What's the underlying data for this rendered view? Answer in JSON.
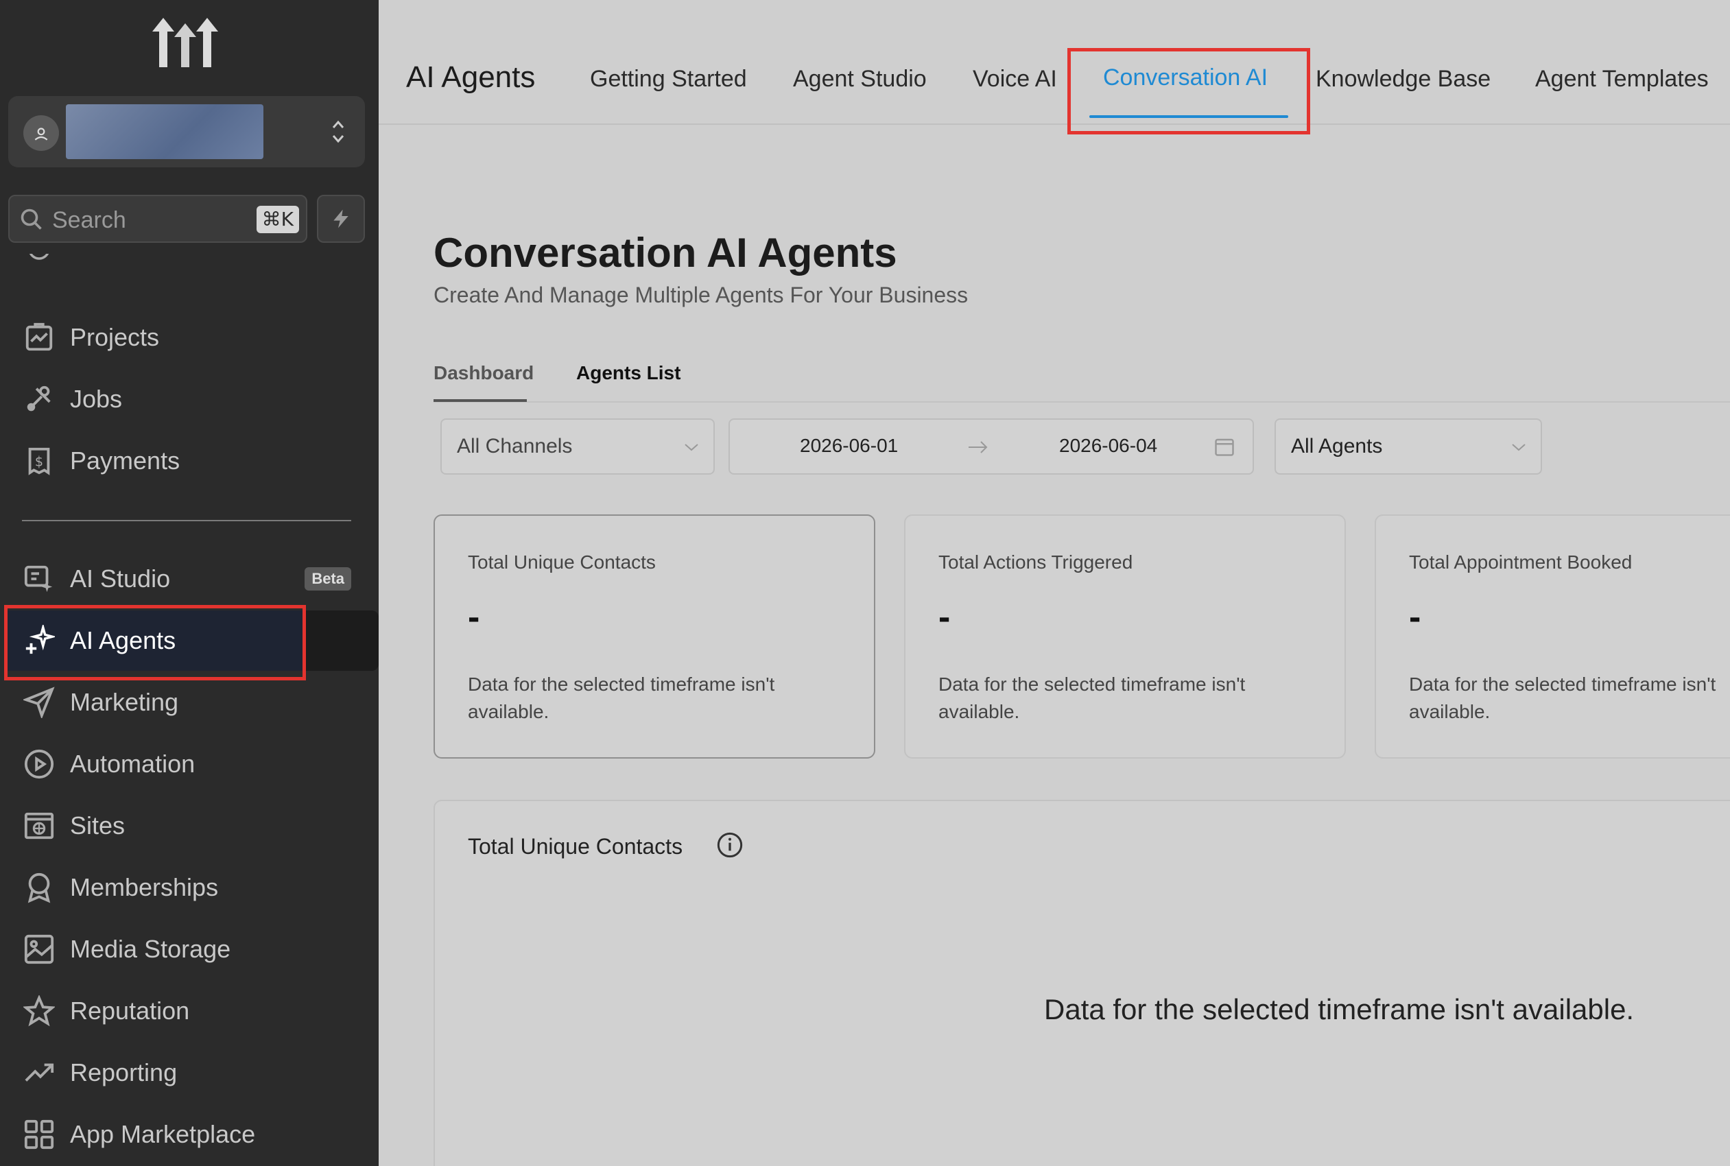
{
  "sidebar": {
    "search": {
      "placeholder": "Search",
      "shortcut": "⌘K"
    },
    "items": [
      {
        "label": "Projects",
        "icon": "projects-icon"
      },
      {
        "label": "Jobs",
        "icon": "tools-icon"
      },
      {
        "label": "Payments",
        "icon": "payments-icon"
      },
      {
        "label": "AI Studio",
        "icon": "ai-studio-icon",
        "badge": "Beta"
      },
      {
        "label": "AI Agents",
        "icon": "sparkle-icon",
        "active": true
      },
      {
        "label": "Marketing",
        "icon": "send-icon"
      },
      {
        "label": "Automation",
        "icon": "automation-icon"
      },
      {
        "label": "Sites",
        "icon": "sites-icon"
      },
      {
        "label": "Memberships",
        "icon": "award-icon"
      },
      {
        "label": "Media Storage",
        "icon": "image-icon"
      },
      {
        "label": "Reputation",
        "icon": "star-icon"
      },
      {
        "label": "Reporting",
        "icon": "trend-icon"
      },
      {
        "label": "App Marketplace",
        "icon": "grid-icon"
      }
    ]
  },
  "header": {
    "title": "AI Agents",
    "tabs": [
      {
        "label": "Getting Started"
      },
      {
        "label": "Agent Studio"
      },
      {
        "label": "Voice AI"
      },
      {
        "label": "Conversation AI",
        "active": true
      },
      {
        "label": "Knowledge Base"
      },
      {
        "label": "Agent Templates"
      }
    ]
  },
  "main": {
    "title": "Conversation AI Agents",
    "subtitle": "Create And Manage Multiple Agents For Your Business",
    "subtabs": [
      {
        "label": "Dashboard",
        "active": true
      },
      {
        "label": "Agents List"
      }
    ],
    "filters": {
      "channels": "All Channels",
      "date_start": "2026-06-01",
      "date_end": "2026-06-04",
      "agents": "All Agents"
    },
    "cards": [
      {
        "title": "Total Unique Contacts",
        "value": "-",
        "message": "Data for the selected timeframe isn't available."
      },
      {
        "title": "Total Actions Triggered",
        "value": "-",
        "message": "Data for the selected timeframe isn't available."
      },
      {
        "title": "Total Appointment Booked",
        "value": "-",
        "message": "Data for the selected timeframe isn't available."
      }
    ],
    "chart_panel": {
      "title": "Total Unique Contacts",
      "message": "Data for the selected timeframe isn't available."
    }
  },
  "colors": {
    "accent": "#1f8ad3",
    "highlight": "#e3342f",
    "sidebar_bg": "#2b2b2b"
  }
}
